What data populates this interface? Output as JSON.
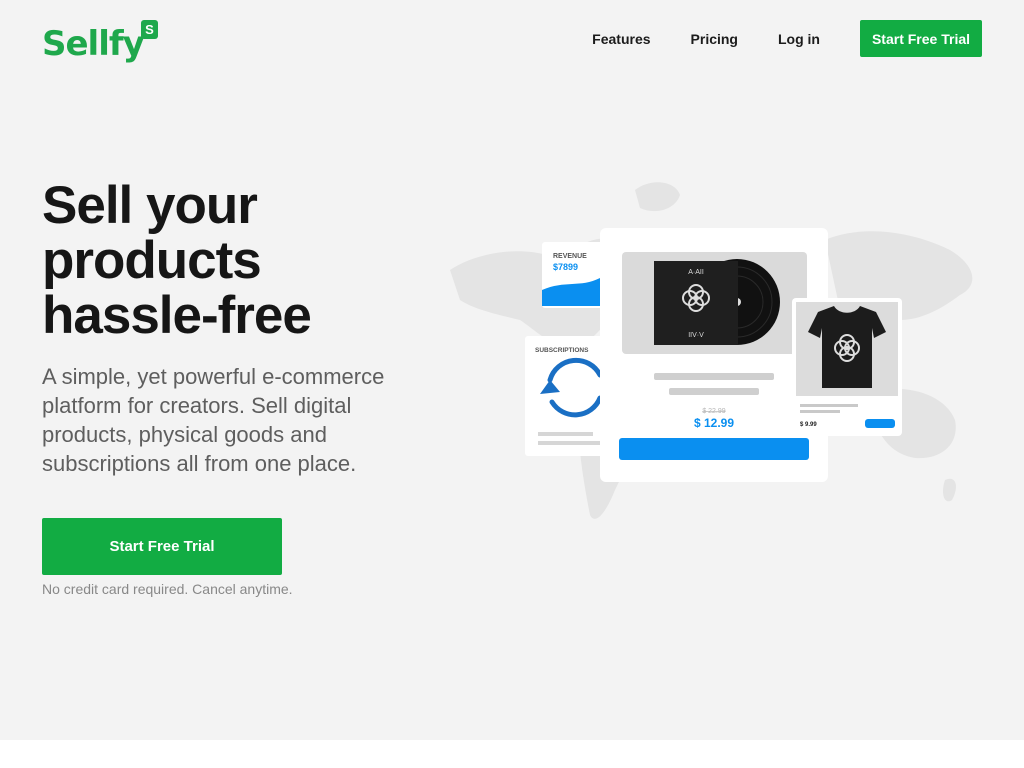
{
  "brand": {
    "name": "Sellfy",
    "badge": "S",
    "color": "#1fa84c"
  },
  "nav": {
    "items": [
      {
        "label": "Features"
      },
      {
        "label": "Pricing"
      },
      {
        "label": "Log in"
      }
    ],
    "cta_label": "Start Free Trial"
  },
  "hero": {
    "title_lines": [
      "Sell your",
      "products",
      "hassle-free"
    ],
    "subtitle": "A simple, yet powerful e-commerce platform for creators. Sell digital products, physical goods and subscriptions all from one place.",
    "cta_label": "Start Free Trial",
    "note": "No credit card required. Cancel anytime."
  },
  "illustration": {
    "revenue_label": "REVENUE",
    "revenue_value": "$7899",
    "subscriptions_label": "SUBSCRIPTIONS",
    "album_top_text": "A·AII",
    "album_bottom_text": "IIV·V",
    "old_price": "$ 22.99",
    "price": "$ 12.99",
    "tshirt_price": "$ 9.99"
  },
  "colors": {
    "accent_green": "#12ac43",
    "accent_blue": "#0a8ff0",
    "background": "#f3f3f3"
  }
}
